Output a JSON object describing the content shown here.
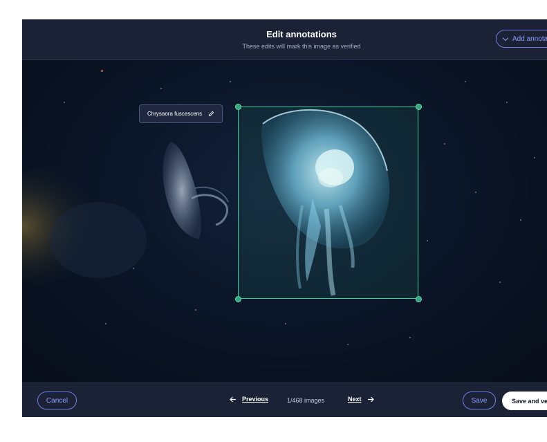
{
  "header": {
    "title": "Edit annotations",
    "subtitle": "These edits will mark this image as verified",
    "add_annotation_label": "Add annota"
  },
  "canvas": {
    "annotation_label": "Chrysaora fuscescens",
    "box_color": "#3fcf9a"
  },
  "footer": {
    "cancel_label": "Cancel",
    "previous_label": "Previous",
    "counter": "1/468 images",
    "next_label": "Next",
    "save_label": "Save",
    "save_verify_label": "Save and ve"
  },
  "colors": {
    "accent": "#8f9dff",
    "panel": "#1b2236",
    "background": "#0b1120",
    "bbox": "#3fcf9a"
  },
  "icons": [
    "chevron-down-icon",
    "pencil-icon",
    "arrow-left-icon",
    "arrow-right-icon"
  ]
}
